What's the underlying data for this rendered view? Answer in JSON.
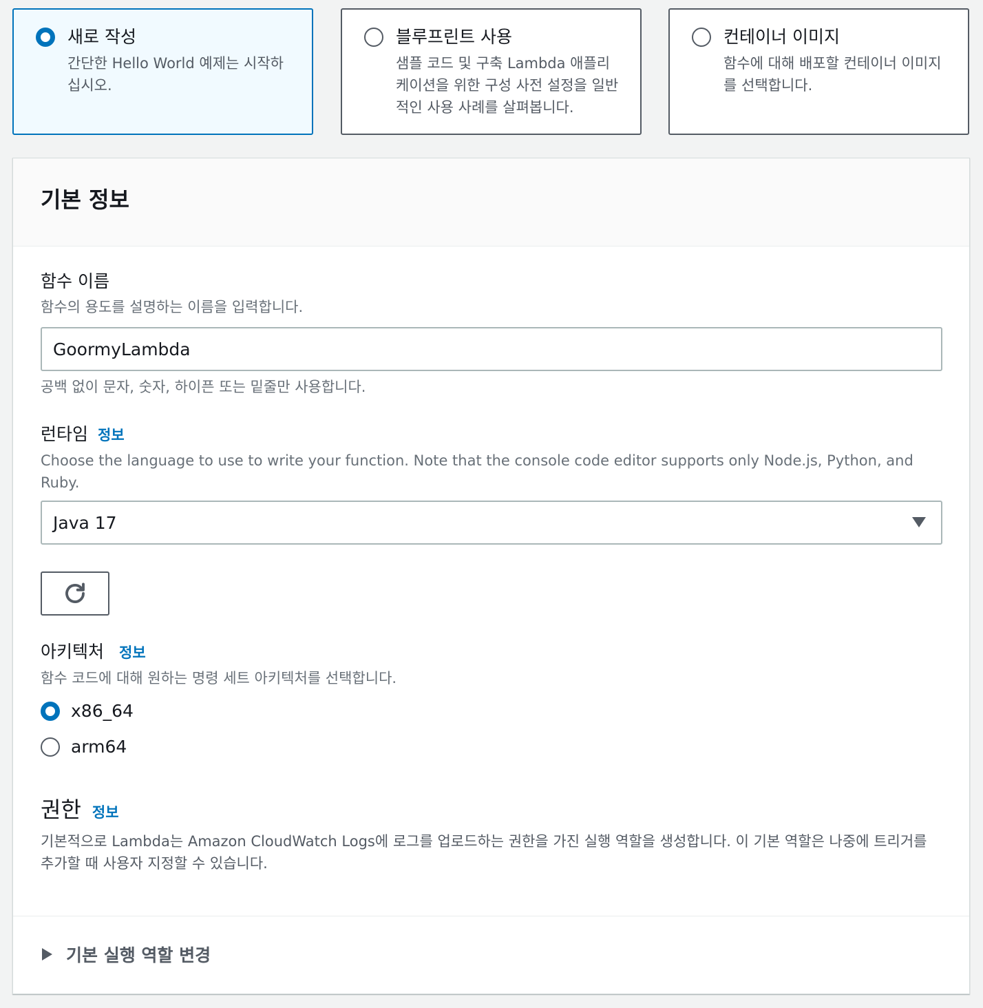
{
  "tiles": [
    {
      "title": "새로 작성",
      "desc": "간단한 Hello World 예제는 시작하십시오.",
      "selected": true
    },
    {
      "title": "블루프린트 사용",
      "desc": "샘플 코드 및 구축 Lambda 애플리케이션을 위한 구성 사전 설정을 일반적인 사용 사례를 살펴봅니다.",
      "selected": false
    },
    {
      "title": "컨테이너 이미지",
      "desc": "함수에 대해 배포할 컨테이너 이미지를 선택합니다.",
      "selected": false
    }
  ],
  "panel": {
    "title": "기본 정보"
  },
  "function_name": {
    "label": "함수 이름",
    "desc": "함수의 용도를 설명하는 이름을 입력합니다.",
    "value": "GoormyLambda",
    "hint": "공백 없이 문자, 숫자, 하이픈 또는 밑줄만 사용합니다."
  },
  "runtime": {
    "label": "런타임",
    "info": "정보",
    "desc": "Choose the language to use to write your function. Note that the console code editor supports only Node.js, Python, and Ruby.",
    "selected": "Java 17"
  },
  "architecture": {
    "label": "아키텍처",
    "info": "정보",
    "desc": "함수 코드에 대해 원하는 명령 세트 아키텍처를 선택합니다.",
    "options": [
      {
        "label": "x86_64",
        "checked": true
      },
      {
        "label": "arm64",
        "checked": false
      }
    ]
  },
  "permissions": {
    "title": "권한",
    "info": "정보",
    "desc": "기본적으로 Lambda는 Amazon CloudWatch Logs에 로그를 업로드하는 권한을 가진 실행 역할을 생성합니다. 이 기본 역할은 나중에 트리거를 추가할 때 사용자 지정할 수 있습니다."
  },
  "expander": {
    "label": "기본 실행 역할 변경"
  },
  "colors": {
    "accent": "#0073bb",
    "selected_bg": "#f1faff",
    "page_bg": "#f2f3f3"
  }
}
